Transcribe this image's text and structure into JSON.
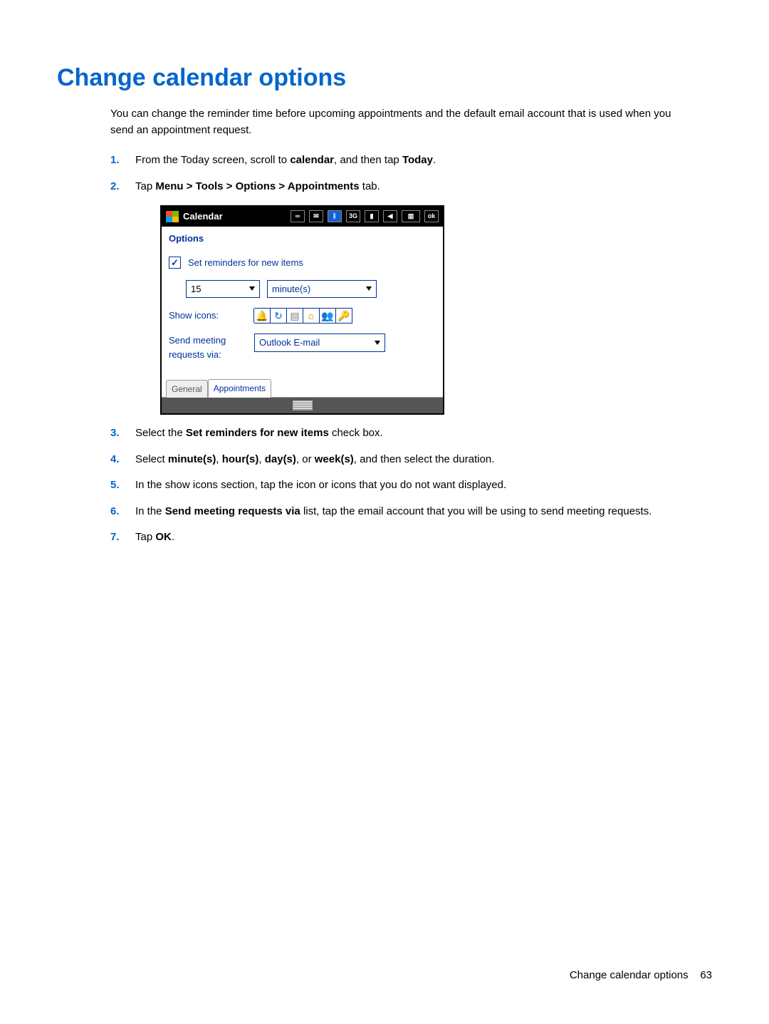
{
  "title": "Change calendar options",
  "intro": "You can change the reminder time before upcoming appointments and the default email account that is used when you send an appointment request.",
  "steps": {
    "s1": {
      "pre": "From the Today screen, scroll to ",
      "b1": "calendar",
      "mid": ", and then tap ",
      "b2": "Today",
      "post": "."
    },
    "s2": {
      "pre": "Tap ",
      "b1": "Menu > Tools > Options > Appointments",
      "post": " tab."
    },
    "s3": {
      "pre": "Select the ",
      "b1": "Set reminders for new items",
      "post": " check box."
    },
    "s4": {
      "pre": "Select ",
      "b1": "minute(s)",
      "c1": ", ",
      "b2": "hour(s)",
      "c2": ", ",
      "b3": "day(s)",
      "c3": ", or ",
      "b4": "week(s)",
      "post": ", and then select the duration."
    },
    "s5": {
      "text": "In the show icons section, tap the icon or icons that you do not want displayed."
    },
    "s6": {
      "pre": "In the ",
      "b1": "Send meeting requests via",
      "post": " list, tap the email account that you will be using to send meeting requests."
    },
    "s7": {
      "pre": "Tap ",
      "b1": "OK",
      "post": "."
    }
  },
  "device": {
    "title": "Calendar",
    "header": "Options",
    "checkbox_label": "Set reminders for new items",
    "number_value": "15",
    "unit_value": "minute(s)",
    "show_icons_label": "Show icons:",
    "send_label_line1": "Send meeting",
    "send_label_line2": "requests via:",
    "mail_value": "Outlook E-mail",
    "tab_general": "General",
    "tab_appt": "Appointments",
    "status_icons": [
      "voicemail-icon",
      "mail-icon",
      "bluetooth-icon",
      "network-3g-icon",
      "signal-icon",
      "volume-icon",
      "battery-icon",
      "ok-icon"
    ],
    "icon_row": [
      "bell-icon",
      "recurring-icon",
      "note-icon",
      "location-icon",
      "attendees-icon",
      "private-icon"
    ]
  },
  "footer": {
    "label": "Change calendar options",
    "page": "63"
  }
}
